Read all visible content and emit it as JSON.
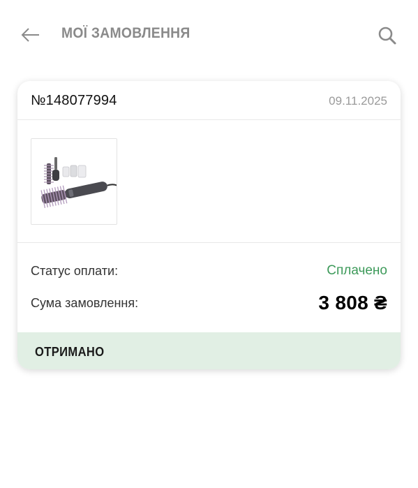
{
  "header": {
    "title": "МОЇ ЗАМОВЛЕННЯ",
    "back_icon": "arrow-left-icon",
    "search_icon": "search-icon"
  },
  "order": {
    "number": "№148077994",
    "date": "09.11.2025",
    "product_image": "hair-styler-product-image",
    "payment_status_label": "Статус оплати:",
    "payment_status_value": "Сплачено",
    "sum_label": "Сума замовлення:",
    "sum_value": "3 808 ₴",
    "status": "ОТРИМАНО"
  },
  "colors": {
    "paid_green": "#3d9a5a",
    "status_bar_bg": "#e1efe4",
    "title_gray": "#8a8a8a"
  }
}
